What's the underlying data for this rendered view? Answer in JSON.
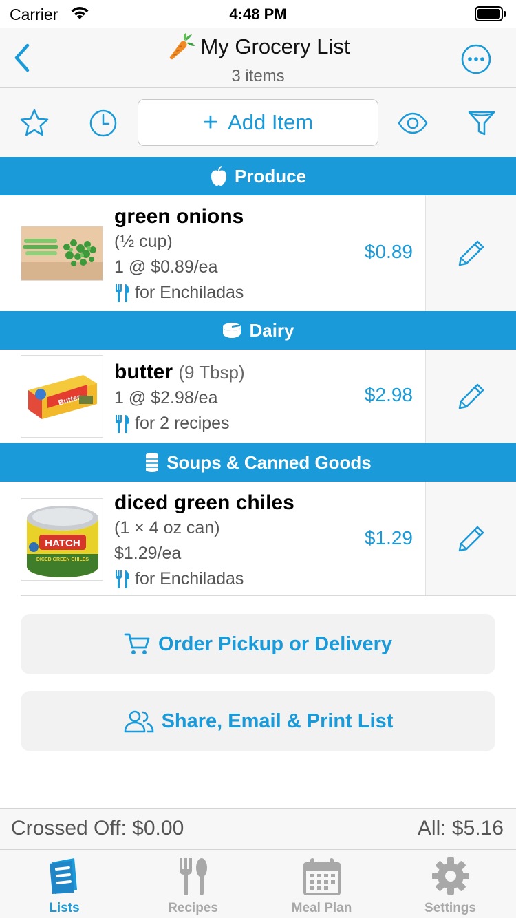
{
  "status_bar": {
    "carrier": "Carrier",
    "time": "4:48 PM"
  },
  "nav": {
    "title": "My Grocery List",
    "subtitle": "3 items",
    "title_icon": "carrot-icon"
  },
  "toolbar": {
    "add_item_label": "Add Item"
  },
  "sections": [
    {
      "title": "Produce",
      "icon": "apple-icon"
    },
    {
      "title": "Dairy",
      "icon": "cheese-icon"
    },
    {
      "title": "Soups & Canned Goods",
      "icon": "can-icon"
    }
  ],
  "items": [
    {
      "name": "green onions",
      "qty": "(½ cup)",
      "price_line": "1 @ $0.89/ea",
      "recipe": "for Enchiladas",
      "price": "$0.89"
    },
    {
      "name": "butter",
      "qty": "(9 Tbsp)",
      "price_line": "1 @ $2.98/ea",
      "recipe": "for 2 recipes",
      "price": "$2.98"
    },
    {
      "name": "diced green chiles",
      "qty": "(1 × 4 oz can)",
      "price_line": "$1.29/ea",
      "recipe": "for Enchiladas",
      "price": "$1.29"
    }
  ],
  "thumb_text": {
    "butter_box": "Butter",
    "hatch_brand": "HATCH",
    "hatch_sub": "DICED GREEN CHILES"
  },
  "actions": {
    "order": "Order Pickup or Delivery",
    "share": "Share, Email & Print List"
  },
  "totals": {
    "crossed_off": "Crossed Off: $0.00",
    "all": "All: $5.16"
  },
  "tabs": [
    {
      "label": "Lists",
      "active": true
    },
    {
      "label": "Recipes",
      "active": false
    },
    {
      "label": "Meal Plan",
      "active": false
    },
    {
      "label": "Settings",
      "active": false
    }
  ],
  "colors": {
    "accent": "#1a9ad9",
    "muted": "#a8a8a8",
    "background": "#f7f7f7"
  }
}
